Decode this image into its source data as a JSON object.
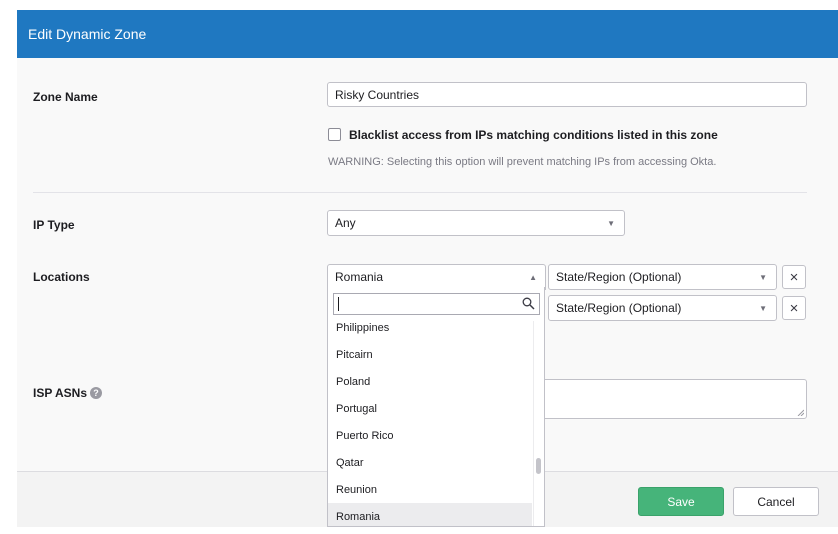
{
  "header": {
    "title": "Edit Dynamic Zone"
  },
  "zone_name": {
    "label": "Zone Name",
    "value": "Risky Countries"
  },
  "blacklist": {
    "label": "Blacklist access from IPs matching conditions listed in this zone",
    "checked": false,
    "warning": "WARNING: Selecting this option will prevent matching IPs from accessing Okta."
  },
  "ip_type": {
    "label": "IP Type",
    "value": "Any"
  },
  "locations": {
    "label": "Locations",
    "rows": [
      {
        "country": "Romania",
        "state_placeholder": "State/Region (Optional)",
        "remove": "×"
      },
      {
        "country": "",
        "state_placeholder": "State/Region (Optional)",
        "remove": "×"
      }
    ],
    "dropdown": {
      "search_value": "",
      "options": [
        "Philippines",
        "Pitcairn",
        "Poland",
        "Portugal",
        "Puerto Rico",
        "Qatar",
        "Reunion",
        "Romania"
      ],
      "selected": "Romania"
    }
  },
  "isp": {
    "label": "ISP ASNs",
    "help": "?"
  },
  "footer": {
    "save": "Save",
    "cancel": "Cancel"
  },
  "icons": {
    "select_up": "▲",
    "select_down": "▼",
    "search": "search-icon",
    "help": "help-icon"
  },
  "colors": {
    "header": "#1f78c1",
    "save": "#46b47a"
  }
}
